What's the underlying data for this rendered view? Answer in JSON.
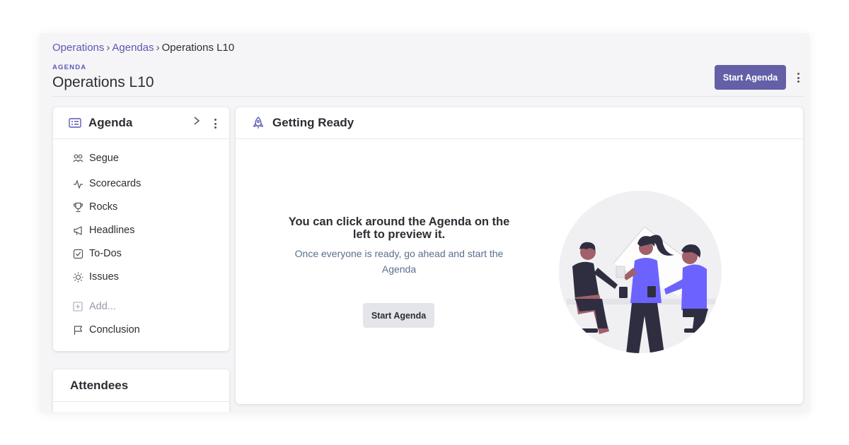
{
  "breadcrumb": {
    "items": [
      "Operations",
      "Agendas",
      "Operations L10"
    ],
    "separator": "›"
  },
  "header": {
    "eyebrow": "AGENDA",
    "title": "Operations L10",
    "start_button": "Start Agenda"
  },
  "agenda_panel": {
    "title": "Agenda",
    "items": [
      {
        "label": "Segue",
        "icon": "people-icon"
      },
      {
        "label": "Scorecards",
        "icon": "pulse-icon"
      },
      {
        "label": "Rocks",
        "icon": "trophy-icon"
      },
      {
        "label": "Headlines",
        "icon": "megaphone-icon"
      },
      {
        "label": "To-Dos",
        "icon": "checkbox-icon"
      },
      {
        "label": "Issues",
        "icon": "sun-icon"
      }
    ],
    "add_label": "Add...",
    "conclusion_label": "Conclusion"
  },
  "attendees_panel": {
    "title": "Attendees"
  },
  "main_panel": {
    "title": "Getting Ready",
    "message_title": "You can click around the Agenda on the left to preview it.",
    "message_sub": "Once everyone is ready, go ahead and start the Agenda",
    "start_button": "Start Agenda"
  },
  "colors": {
    "accent": "#6360a8",
    "link": "#5b57b8",
    "subtext": "#5b6f8c",
    "figure_purple": "#6c63ff",
    "figure_dark": "#2f2e41"
  }
}
